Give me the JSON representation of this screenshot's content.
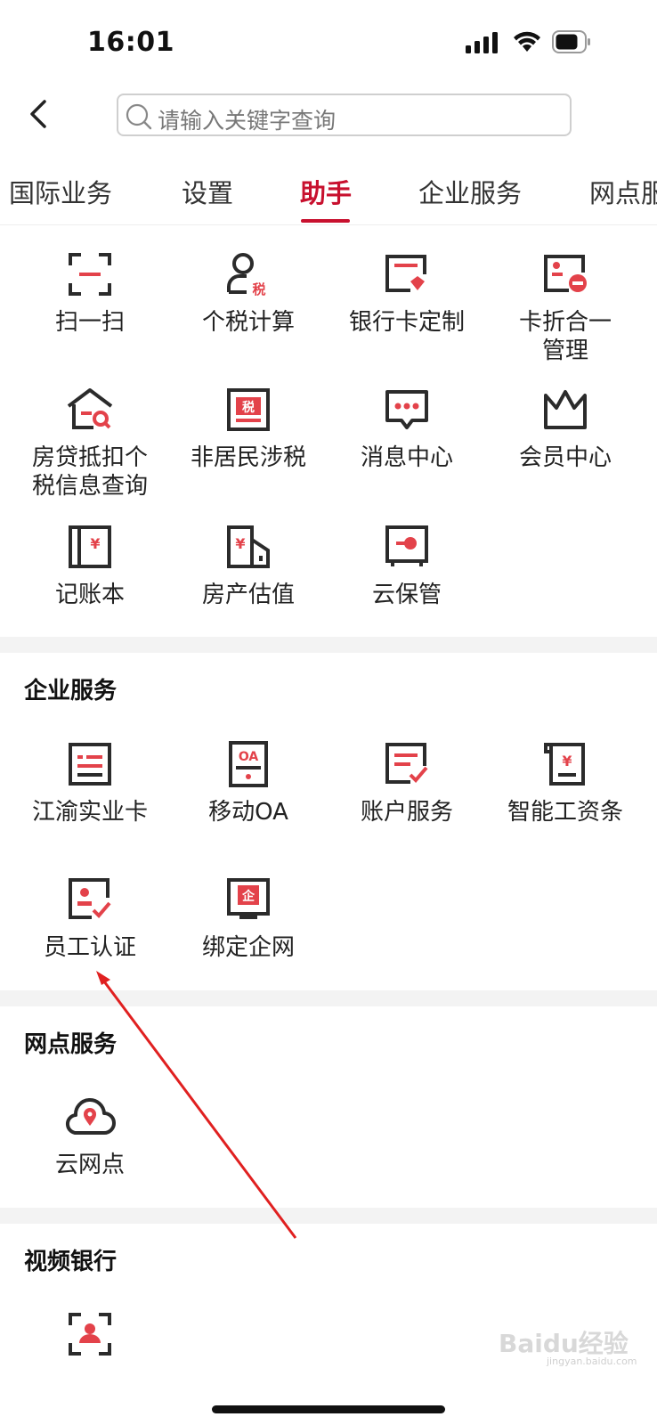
{
  "status_bar": {
    "time": "16:01"
  },
  "search": {
    "placeholder": "请输入关键字查询"
  },
  "tabs": [
    {
      "label": "国际业务"
    },
    {
      "label": "设置"
    },
    {
      "label": "助手",
      "active": true
    },
    {
      "label": "企业服务"
    },
    {
      "label": "网点服务"
    }
  ],
  "assistant_grid": [
    {
      "label": "扫一扫",
      "icon": "scan-icon"
    },
    {
      "label": "个税计算",
      "icon": "tax-calc-icon"
    },
    {
      "label": "银行卡定制",
      "icon": "card-custom-icon"
    },
    {
      "label": "卡折合一\n管理",
      "icon": "card-merge-icon"
    },
    {
      "label": "房贷抵扣个\n税信息查询",
      "icon": "mortgage-search-icon"
    },
    {
      "label": "非居民涉税",
      "icon": "nonresident-tax-icon"
    },
    {
      "label": "消息中心",
      "icon": "message-icon"
    },
    {
      "label": "会员中心",
      "icon": "crown-icon"
    },
    {
      "label": "记账本",
      "icon": "ledger-icon"
    },
    {
      "label": "房产估值",
      "icon": "property-value-icon"
    },
    {
      "label": "云保管",
      "icon": "safe-icon"
    }
  ],
  "sections": {
    "enterprise": {
      "title": "企业服务",
      "items": [
        {
          "label": "江渝实业卡",
          "icon": "industry-card-icon"
        },
        {
          "label": "移动OA",
          "icon": "mobile-oa-icon",
          "badge": "OA"
        },
        {
          "label": "账户服务",
          "icon": "account-service-icon"
        },
        {
          "label": "智能工资条",
          "icon": "payslip-icon"
        },
        {
          "label": "员工认证",
          "icon": "employee-verify-icon"
        },
        {
          "label": "绑定企网",
          "icon": "bind-enterprise-icon",
          "badge": "企"
        }
      ]
    },
    "outlet": {
      "title": "网点服务",
      "items": [
        {
          "label": "云网点",
          "icon": "cloud-location-icon"
        }
      ]
    },
    "video": {
      "title": "视频银行",
      "items": [
        {
          "icon": "video-bank-icon"
        }
      ]
    }
  },
  "icon_text": {
    "tax": "税",
    "yuan": "¥"
  },
  "colors": {
    "accent": "#c8102e",
    "icon_dark": "#2b2b2b",
    "icon_red": "#e3424a"
  },
  "watermark": {
    "logo": "Baidu经验",
    "url": "jingyan.baidu.com"
  }
}
